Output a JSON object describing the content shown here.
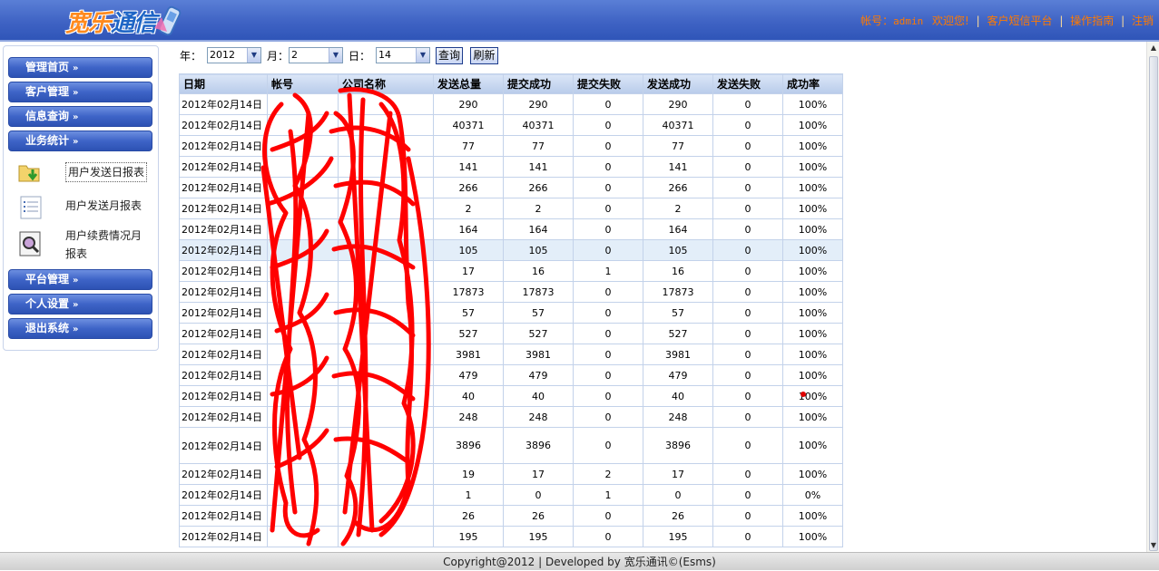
{
  "header": {
    "logo_part1": "宽乐",
    "logo_part2": "通信",
    "account_label": "帐号：",
    "account_value": "admin",
    "welcome": "欢迎您!",
    "links": [
      "客户短信平台",
      "操作指南",
      "注销"
    ],
    "sep": "|"
  },
  "sidebar": {
    "menus_top": [
      {
        "label": "管理首页"
      },
      {
        "label": "客户管理"
      },
      {
        "label": "信息查询"
      },
      {
        "label": "业务统计"
      }
    ],
    "sub_items": [
      {
        "label": "用户发送日报表",
        "icon": "folder-download-icon"
      },
      {
        "label": "用户发送月报表",
        "icon": "list-icon"
      },
      {
        "label": "用户续费情况月",
        "label2": "报表",
        "icon": "report-magnifier-icon"
      }
    ],
    "menus_bottom": [
      {
        "label": "平台管理"
      },
      {
        "label": "个人设置"
      },
      {
        "label": "退出系统"
      }
    ],
    "chevron": "»"
  },
  "query": {
    "year_label": "年：",
    "year_value": "2012",
    "month_label": "月：",
    "month_value": "2",
    "day_label": "日：",
    "day_value": "14",
    "search_button": "查询",
    "refresh_button": "刷新"
  },
  "table": {
    "headers": [
      "日期",
      "帐号",
      "公司名称",
      "发送总量",
      "提交成功",
      "提交失败",
      "发送成功",
      "发送失败",
      "成功率"
    ],
    "rows": [
      [
        "2012年02月14日",
        "",
        "",
        "290",
        "290",
        "0",
        "290",
        "0",
        "100%"
      ],
      [
        "2012年02月14日",
        "",
        "",
        "40371",
        "40371",
        "0",
        "40371",
        "0",
        "100%"
      ],
      [
        "2012年02月14日",
        "",
        "",
        "77",
        "77",
        "0",
        "77",
        "0",
        "100%"
      ],
      [
        "2012年02月14日",
        "",
        "",
        "141",
        "141",
        "0",
        "141",
        "0",
        "100%"
      ],
      [
        "2012年02月14日",
        "",
        "",
        "266",
        "266",
        "0",
        "266",
        "0",
        "100%"
      ],
      [
        "2012年02月14日",
        "",
        "",
        "2",
        "2",
        "0",
        "2",
        "0",
        "100%"
      ],
      [
        "2012年02月14日",
        "",
        "",
        "164",
        "164",
        "0",
        "164",
        "0",
        "100%"
      ],
      [
        "2012年02月14日",
        "",
        "",
        "105",
        "105",
        "0",
        "105",
        "0",
        "100%"
      ],
      [
        "2012年02月14日",
        "",
        "",
        "17",
        "16",
        "1",
        "16",
        "0",
        "100%"
      ],
      [
        "2012年02月14日",
        "",
        "",
        "17873",
        "17873",
        "0",
        "17873",
        "0",
        "100%"
      ],
      [
        "2012年02月14日",
        "",
        "",
        "57",
        "57",
        "0",
        "57",
        "0",
        "100%"
      ],
      [
        "2012年02月14日",
        "",
        "",
        "527",
        "527",
        "0",
        "527",
        "0",
        "100%"
      ],
      [
        "2012年02月14日",
        "",
        "",
        "3981",
        "3981",
        "0",
        "3981",
        "0",
        "100%"
      ],
      [
        "2012年02月14日",
        "",
        "",
        "479",
        "479",
        "0",
        "479",
        "0",
        "100%"
      ],
      [
        "2012年02月14日",
        "",
        "",
        "40",
        "40",
        "0",
        "40",
        "0",
        "100%"
      ],
      [
        "2012年02月14日",
        "",
        "",
        "248",
        "248",
        "0",
        "248",
        "0",
        "100%"
      ],
      [
        "2012年02月14日",
        "",
        "",
        "3896",
        "3896",
        "0",
        "3896",
        "0",
        "100%"
      ],
      [
        "2012年02月14日",
        "",
        "",
        "19",
        "17",
        "2",
        "17",
        "0",
        "100%"
      ],
      [
        "2012年02月14日",
        "",
        "",
        "1",
        "0",
        "1",
        "0",
        "0",
        "0%"
      ],
      [
        "2012年02月14日",
        "",
        "",
        "26",
        "26",
        "0",
        "26",
        "0",
        "100%"
      ],
      [
        "2012年02月14日",
        "",
        "",
        "195",
        "195",
        "0",
        "195",
        "0",
        "100%"
      ]
    ],
    "highlight_row": 7,
    "tall_row": 16
  },
  "footer": {
    "text": "Copyright@2012 | Developed by 宽乐通讯©(Esms)"
  },
  "colors": {
    "header_blue": "#3f63c4",
    "link_orange": "#ff7a00",
    "scribble_red": "#ff0000"
  }
}
